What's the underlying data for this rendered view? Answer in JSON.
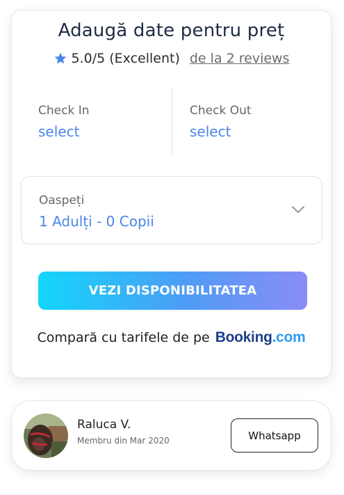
{
  "booking_card": {
    "title": "Adaugă date pentru preț",
    "rating": "5.0/5 (Excellent)",
    "reviews_link": "de la 2 reviews",
    "check_in": {
      "label": "Check In",
      "value": "select"
    },
    "check_out": {
      "label": "Check Out",
      "value": "select"
    },
    "guests": {
      "label": "Oaspeți",
      "value": "1 Adulți - 0 Copii"
    },
    "cta_label": "VEZI DISPONIBILITATEA",
    "compare_text": "Compară cu tarifele de pe",
    "booking_logo": {
      "part1": "Booking",
      "part2": ".com"
    }
  },
  "host": {
    "name": "Raluca V.",
    "member_since": "Membru din Mar 2020",
    "whatsapp_label": "Whatsapp"
  },
  "colors": {
    "accent_blue": "#4a86e8",
    "cta_gradient_start": "#12d6fb",
    "cta_gradient_end": "#8b8cf6",
    "star": "#4a86e8"
  },
  "icons": [
    "star-icon",
    "chevron-down-icon",
    "avatar"
  ]
}
